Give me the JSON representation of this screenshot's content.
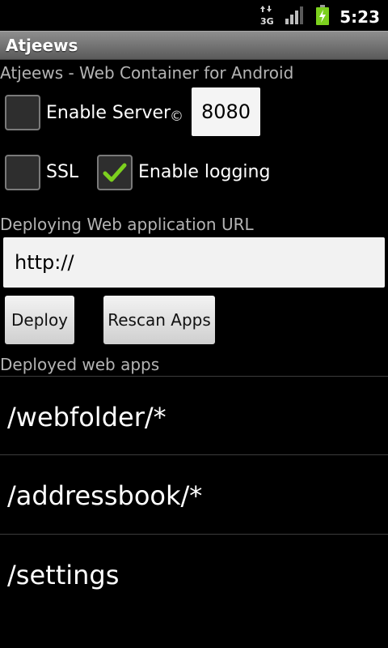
{
  "status_bar": {
    "network_label": "3G",
    "time": "5:23",
    "battery_color": "#7cd01e"
  },
  "app": {
    "title": "Atjeews",
    "subtitle": "Atjeews - Web Container for Android"
  },
  "server": {
    "enable_server_label": "Enable Server",
    "enable_server_checked": false,
    "copyright_symbol": "©",
    "port_value": "8080"
  },
  "options": {
    "ssl_label": "SSL",
    "ssl_checked": false,
    "logging_label": "Enable logging",
    "logging_checked": true
  },
  "deploy": {
    "url_label": "Deploying Web application URL",
    "url_value": "http://",
    "deploy_button": "Deploy",
    "rescan_button": "Rescan Apps"
  },
  "deployed": {
    "label": "Deployed web apps",
    "items": [
      {
        "label": "/webfolder/*"
      },
      {
        "label": "/addressbook/*"
      },
      {
        "label": "/settings"
      }
    ]
  }
}
